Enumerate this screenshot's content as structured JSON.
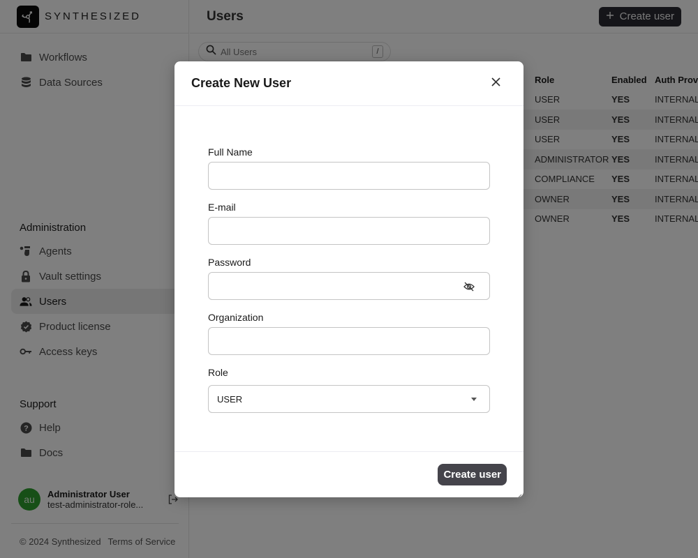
{
  "brand": {
    "name": "SYNTHESIZED",
    "logo_icon": "synthesized-logo-icon"
  },
  "sidebar": {
    "main_items": [
      {
        "label": "Workflows",
        "icon": "folder-icon"
      },
      {
        "label": "Data Sources",
        "icon": "database-icon"
      }
    ],
    "admin_title": "Administration",
    "admin_items": [
      {
        "label": "Agents",
        "icon": "agents-icon",
        "active": false
      },
      {
        "label": "Vault settings",
        "icon": "lock-icon",
        "active": false
      },
      {
        "label": "Users",
        "icon": "users-icon",
        "active": true
      },
      {
        "label": "Product license",
        "icon": "badge-check-icon",
        "active": false
      },
      {
        "label": "Access keys",
        "icon": "key-icon",
        "active": false
      }
    ],
    "support_title": "Support",
    "support_items": [
      {
        "label": "Help",
        "icon": "help-icon"
      },
      {
        "label": "Docs",
        "icon": "folder-icon"
      }
    ],
    "user": {
      "initials": "au",
      "name": "Administrator User",
      "email": "test-administrator-role...",
      "avatar_color": "#2f9e2f"
    },
    "footer": {
      "copyright": "© 2024 Synthesized",
      "terms": "Terms of Service"
    }
  },
  "main": {
    "title": "Users",
    "create_button": "Create user",
    "search": {
      "placeholder": "All Users",
      "shortcut": "/"
    },
    "table": {
      "headers": {
        "role": "Role",
        "enabled": "Enabled",
        "auth": "Auth Provic"
      },
      "rows": [
        {
          "role": "USER",
          "enabled": "YES",
          "auth": "INTERNAL"
        },
        {
          "role": "USER",
          "enabled": "YES",
          "auth": "INTERNAL"
        },
        {
          "role": "USER",
          "enabled": "YES",
          "auth": "INTERNAL"
        },
        {
          "role": "ADMINISTRATOR",
          "enabled": "YES",
          "auth": "INTERNAL"
        },
        {
          "role": "COMPLIANCE",
          "enabled": "YES",
          "auth": "INTERNAL"
        },
        {
          "role": "OWNER",
          "enabled": "YES",
          "auth": "INTERNAL"
        },
        {
          "role": "OWNER",
          "enabled": "YES",
          "auth": "INTERNAL"
        }
      ]
    }
  },
  "modal": {
    "title": "Create New User",
    "fields": {
      "full_name": {
        "label": "Full Name",
        "value": ""
      },
      "email": {
        "label": "E-mail",
        "value": ""
      },
      "password": {
        "label": "Password",
        "value": ""
      },
      "organization": {
        "label": "Organization",
        "value": ""
      },
      "role": {
        "label": "Role",
        "value": "USER"
      }
    },
    "submit_label": "Create user"
  },
  "colors": {
    "primary_button": "#2a2a33",
    "modal_button": "#45444b",
    "overlay": "rgba(0,0,0,0.5)"
  }
}
